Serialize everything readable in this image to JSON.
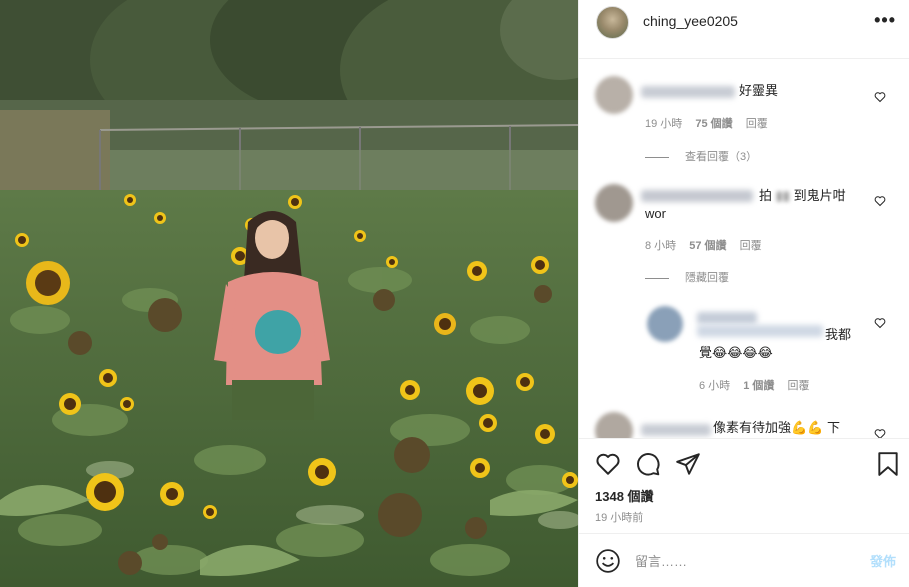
{
  "post": {
    "username": "ching_yee0205",
    "more_icon": "more-horizontal-icon",
    "views_label": "1348 個讚",
    "time_ago": "19 小時前"
  },
  "comments": [
    {
      "text": "好靈異",
      "time": "19 小時",
      "likes": "75 個讚",
      "reply": "回覆",
      "view_replies": "查看回覆（3）"
    },
    {
      "text_line1": "拍",
      "text_line1b": "到鬼片咁",
      "text_line2": "wor",
      "time": "8 小時",
      "likes": "57 個讚",
      "reply": "回覆",
      "hide_replies": "隱藏回覆"
    },
    {
      "text_line1": "我都",
      "text_line2": "覺😂😂😂😂",
      "time": "6 小時",
      "likes": "1 個讚",
      "reply": "回覆"
    },
    {
      "text": "像素有待加強💪💪 下"
    }
  ],
  "composer": {
    "placeholder": "留言……",
    "post_label": "發佈"
  },
  "icons": {
    "like": "heart-icon",
    "comment": "comment-icon",
    "share": "share-icon",
    "save": "bookmark-icon",
    "emoji": "emoji-icon"
  }
}
